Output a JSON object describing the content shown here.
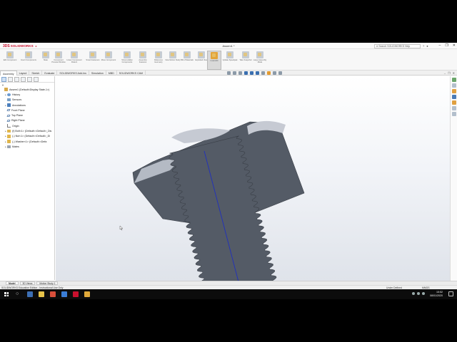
{
  "window": {
    "document_title": "Assem1 *",
    "brand": "SOLIDWORKS",
    "brand_mark": "3DS",
    "search_placeholder": "Search SOLIDWORKS Help",
    "controls": [
      "–",
      "❐",
      "✕"
    ]
  },
  "command_manager": {
    "items": [
      {
        "label": "Edit Component",
        "icon": "edit-component-icon"
      },
      {
        "label": "Insert Components",
        "icon": "insert-components-icon"
      },
      {
        "label": "Mate",
        "icon": "mate-icon"
      },
      {
        "label": "Component Preview Window",
        "icon": "component-preview-icon"
      },
      {
        "label": "Linear Component Pattern",
        "icon": "linear-pattern-icon"
      },
      {
        "label": "Smart Fasteners",
        "icon": "smart-fasteners-icon"
      },
      {
        "label": "Move Component",
        "icon": "move-component-icon"
      },
      {
        "label": "Show Hidden Components",
        "icon": "show-hidden-icon"
      },
      {
        "label": "Assembly Features",
        "icon": "assembly-features-icon"
      },
      {
        "label": "Reference Geometry",
        "icon": "reference-geometry-icon"
      },
      {
        "label": "New Motion Study",
        "icon": "motion-study-icon"
      },
      {
        "label": "Bill of Materials",
        "icon": "bom-icon"
      },
      {
        "label": "Exploded View",
        "icon": "exploded-view-icon"
      },
      {
        "label": "Instant3D",
        "icon": "instant3d-icon"
      },
      {
        "label": "Update Speedpak",
        "icon": "speedpak-icon"
      },
      {
        "label": "Take Snapshot",
        "icon": "snapshot-icon"
      },
      {
        "label": "Large Assembly Mode",
        "icon": "large-assembly-icon"
      }
    ],
    "active_label": "Instant3D"
  },
  "tabs": [
    "Assembly",
    "Layout",
    "Sketch",
    "Evaluate",
    "SOLIDWORKS Add-Ins",
    "Simulation",
    "MBD",
    "SOLIDWORKS CAM"
  ],
  "active_tab": "Assembly",
  "feature_tree": {
    "items": [
      {
        "label": "Assem1 (Default<Display State-1>)",
        "icon": "assembly",
        "indent": 0,
        "expander": ""
      },
      {
        "label": "History",
        "icon": "history",
        "indent": 1,
        "expander": "▸"
      },
      {
        "label": "Sensors",
        "icon": "sensor",
        "indent": 1,
        "expander": ""
      },
      {
        "label": "Annotations",
        "icon": "annotation",
        "indent": 1,
        "expander": "▸"
      },
      {
        "label": "Front Plane",
        "icon": "plane",
        "indent": 1,
        "expander": ""
      },
      {
        "label": "Top Plane",
        "icon": "plane",
        "indent": 1,
        "expander": ""
      },
      {
        "label": "Right Plane",
        "icon": "plane",
        "indent": 1,
        "expander": ""
      },
      {
        "label": "Origin",
        "icon": "origin",
        "indent": 1,
        "expander": ""
      },
      {
        "label": "(f) Bolt<1> (Default<<Default>_Dis",
        "icon": "part",
        "indent": 1,
        "expander": "▸"
      },
      {
        "label": "(-) Nut<1> (Default<<Default>_Di",
        "icon": "part",
        "indent": 1,
        "expander": "▸"
      },
      {
        "label": "(-) Washer<1> (Default<<Defa",
        "icon": "part",
        "indent": 1,
        "expander": "▸"
      },
      {
        "label": "Mates",
        "icon": "mate",
        "indent": 1,
        "expander": "▸"
      }
    ]
  },
  "bottom_tabs": [
    "Model",
    "3D Views",
    "Motion Study 1"
  ],
  "active_bottom_tab": "Model",
  "status": {
    "edition": "SOLIDWORKS Education Edition - Instructional Use Only",
    "definition": "Under Defined",
    "units": "MMGS"
  },
  "taskbar": {
    "time": "15:52",
    "date": "08/01/2020"
  },
  "colors": {
    "part_face": "#545b66",
    "part_top_face": "#c5c9d2",
    "axis_line": "#1f2fbf",
    "brand_red": "#c8102e",
    "triad_x": "#d0352f",
    "triad_y": "#2fa84a",
    "triad_z": "#2f55d4"
  }
}
